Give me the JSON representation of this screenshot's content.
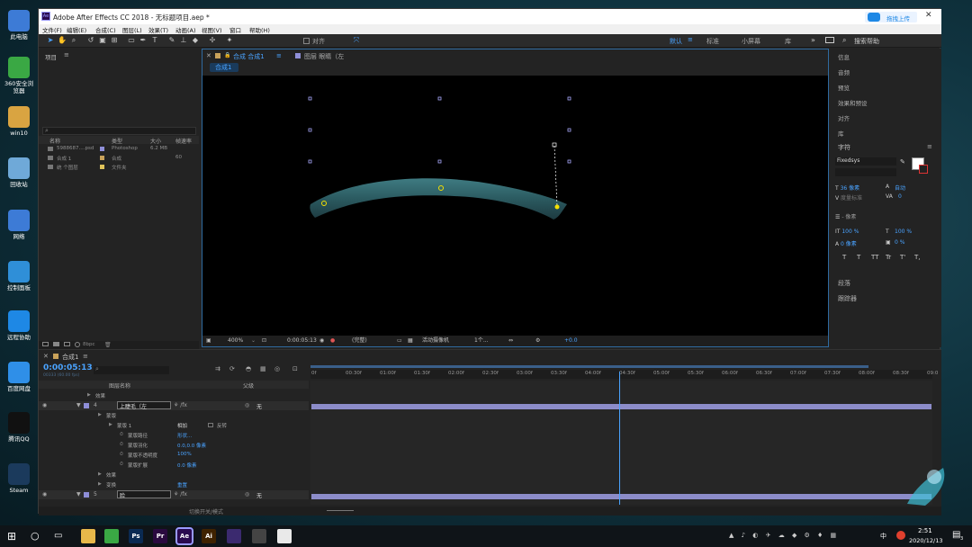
{
  "desktop": {
    "icons": [
      {
        "label": "此电脑",
        "color": "#3d7bd6"
      },
      {
        "label": "360安全浏览器",
        "color": "#3aa844"
      },
      {
        "label": "win10",
        "color": "#d9a441"
      },
      {
        "label": "回收站",
        "color": "#6fa9d8"
      },
      {
        "label": "网络",
        "color": "#3d7bd6"
      },
      {
        "label": "控制面板",
        "color": "#2f8fd8"
      },
      {
        "label": "远程协助",
        "color": "#1e88e5"
      },
      {
        "label": "百度网盘",
        "color": "#2f8fe8"
      },
      {
        "label": "腾讯QQ",
        "color": "#111111"
      },
      {
        "label": "Steam",
        "color": "#1b3a5c"
      }
    ]
  },
  "window": {
    "title": "Adobe After Effects CC 2018 - 无标题项目.aep *",
    "upload_button": "拖拽上传",
    "close_glyph": "✕"
  },
  "menu": [
    "文件(F)",
    "编辑(E)",
    "合成(C)",
    "图层(L)",
    "效果(T)",
    "动画(A)",
    "视图(V)",
    "窗口",
    "帮助(H)"
  ],
  "toolbar": {
    "snap_label": "对齐",
    "workspaces": [
      "默认",
      "标准",
      "小屏幕",
      "库"
    ],
    "active_workspace": "默认",
    "search_placeholder": "搜索帮助"
  },
  "project": {
    "title": "项目",
    "search_placeholder": "",
    "columns": [
      "名称",
      "类型",
      "大小",
      "帧速率"
    ],
    "items": [
      {
        "name": "5988687....psd",
        "type": "Photoshop",
        "size": "6.2 MB",
        "fps": "",
        "color": "#8f8fd8"
      },
      {
        "name": "合成 1",
        "type": "合成",
        "size": "",
        "fps": "60",
        "color": "#c9a25a"
      },
      {
        "name": "统 个图层",
        "type": "文件夹",
        "size": "",
        "fps": "",
        "color": "#e0c35a"
      }
    ],
    "bpc": "8bpc"
  },
  "composition": {
    "tab_label": "合成 合成1",
    "layer_tab": "图层 眼睛（左",
    "breadcrumb": "合成1",
    "zoom": "400%",
    "timecode": "0:00:05:13",
    "quality": "(完整)",
    "camera": "活动摄像机",
    "views": "1个...",
    "exposure": "+0.0"
  },
  "right_panel": {
    "items": [
      "信息",
      "音频",
      "预览",
      "效果和预设",
      "对齐",
      "库"
    ],
    "character_title": "字符",
    "font": "Fixedsys",
    "font_size": "36 像素",
    "leading": "自动",
    "kerning": "度量标准",
    "tracking": "0",
    "stroke": "- 像素",
    "vscale": "100 %",
    "hscale": "100 %",
    "baseline": "0 像素",
    "tsume": "0 %",
    "text_styles": [
      "T",
      "T",
      "TT",
      "Tr",
      "T'",
      "T,"
    ],
    "paragraph": "段落",
    "tracker": "跟踪器"
  },
  "timeline": {
    "tab_label": "合成1",
    "timecode": "0:00:05:13",
    "timecode_sub": "00333 (60.00 fps)",
    "header": {
      "layer_name": "图层名称",
      "parent": "父级"
    },
    "ruler": [
      "0f",
      "00:30f",
      "01:00f",
      "01:30f",
      "02:00f",
      "02:30f",
      "03:00f",
      "03:30f",
      "04:00f",
      "04:30f",
      "05:00f",
      "05:30f",
      "06:00f",
      "06:30f",
      "07:00f",
      "07:30f",
      "08:00f",
      "08:30f",
      "09:0"
    ],
    "current_time_fraction": 0.5,
    "rows": [
      {
        "indent": 0,
        "label": "效果",
        "extra": ""
      },
      {
        "indent": 0,
        "num": "4",
        "label": "上睫毛（左",
        "parent": "无",
        "type": "layer"
      },
      {
        "indent": 1,
        "label": "蒙版",
        "extra": ""
      },
      {
        "indent": 2,
        "label": "蒙版 1",
        "mode": "相加",
        "invert": "反转"
      },
      {
        "indent": 3,
        "label": "蒙版路径",
        "value": "形状..."
      },
      {
        "indent": 3,
        "label": "蒙版羽化",
        "value": "0.0,0.0 像素"
      },
      {
        "indent": 3,
        "label": "蒙版不透明度",
        "value": "100%"
      },
      {
        "indent": 3,
        "label": "蒙版扩展",
        "value": "0.0 像素"
      },
      {
        "indent": 1,
        "label": "效果",
        "extra": ""
      },
      {
        "indent": 1,
        "label": "变换",
        "value": "重置"
      },
      {
        "indent": 0,
        "num": "5",
        "label": "脸",
        "parent": "无",
        "type": "layer"
      }
    ],
    "footer": "切换开关/模式"
  },
  "taskbar": {
    "apps": [
      {
        "name": "file-explorer",
        "label": "",
        "color": "#e8b84a"
      },
      {
        "name": "360-browser",
        "label": "",
        "color": "#3aa844"
      },
      {
        "name": "photoshop",
        "label": "Ps",
        "color": "#0a2a52"
      },
      {
        "name": "premiere",
        "label": "Pr",
        "color": "#2a0a3f"
      },
      {
        "name": "after-effects",
        "label": "Ae",
        "color": "#2a0a4f"
      },
      {
        "name": "illustrator",
        "label": "Ai",
        "color": "#3f2200"
      },
      {
        "name": "purple-app",
        "label": "",
        "color": "#3b2a6f"
      },
      {
        "name": "avatar-app",
        "label": "",
        "color": "#444"
      },
      {
        "name": "settings-app",
        "label": "",
        "color": "#e9e9e9"
      }
    ],
    "time": "2:51",
    "date": "2020/12/13",
    "ime": "中",
    "notif_count": "3"
  }
}
